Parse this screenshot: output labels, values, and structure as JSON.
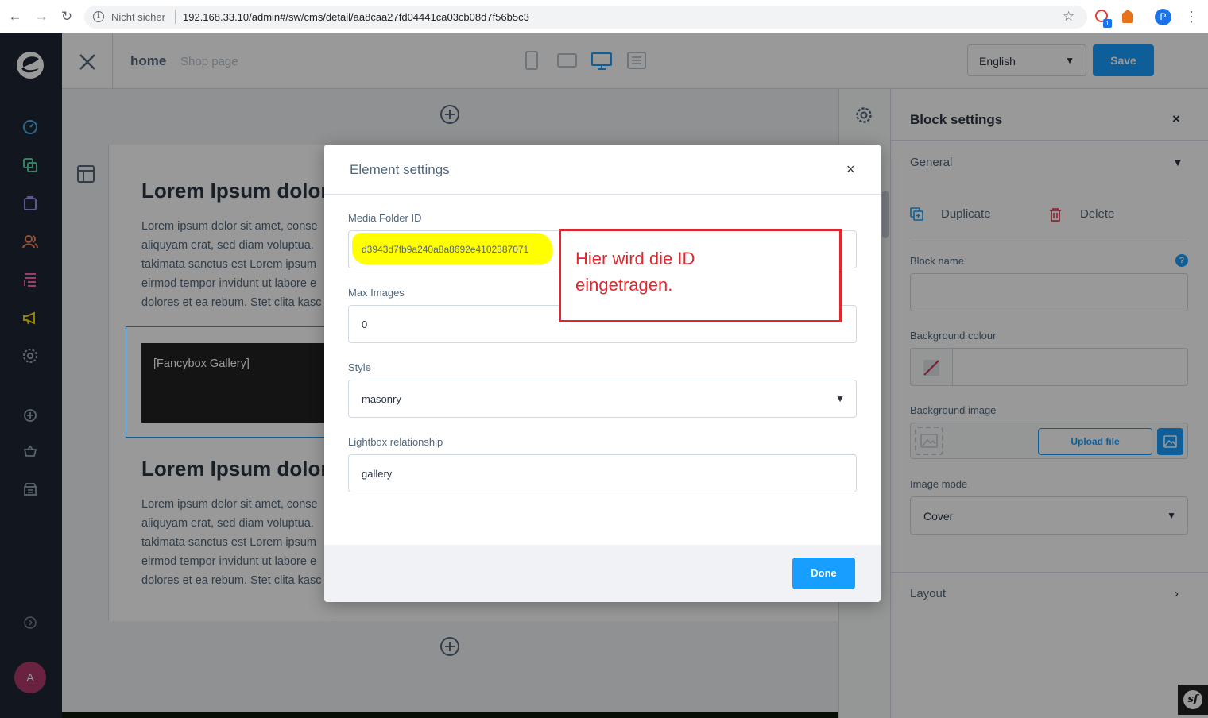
{
  "browser": {
    "back": "←",
    "forward": "→",
    "reload": "↻",
    "security": "Nicht sicher",
    "url": "192.168.33.10/admin#/sw/cms/detail/aa8caa27fd04441ca03cb08d7f56b5c3",
    "star": "☆",
    "ext_badge": "1",
    "profile_initial": "P",
    "menu": "⋮"
  },
  "sidebar": {
    "icons": [
      "dashboard-icon",
      "catalogue-icon",
      "orders-icon",
      "customers-icon",
      "content-icon",
      "marketing-icon",
      "settings-icon",
      "add-icon",
      "sales-channel-icon",
      "storefront-icon",
      "help-icon"
    ],
    "avatar_initial": "A"
  },
  "topbar": {
    "page_title": "home",
    "page_type": "Shop page",
    "language": "English",
    "save_label": "Save"
  },
  "preview": {
    "heading1": "Lorem Ipsum dolor",
    "para1": [
      "Lorem ipsum dolor sit amet, conse",
      "aliquyam erat, sed diam voluptua.",
      "takimata sanctus est Lorem ipsum",
      "eirmod tempor invidunt ut labore e",
      "dolores et ea rebum. Stet clita kasc"
    ],
    "gallery_label": "[Fancybox Gallery]",
    "heading2": "Lorem Ipsum dolor",
    "para2": [
      "Lorem ipsum dolor sit amet, conse",
      "aliquyam erat, sed diam voluptua.",
      "takimata sanctus est Lorem ipsum",
      "eirmod tempor invidunt ut labore e",
      "dolores et ea rebum. Stet clita kasc"
    ]
  },
  "block_settings": {
    "title": "Block settings",
    "close": "×",
    "general": "General",
    "duplicate": "Duplicate",
    "delete": "Delete",
    "block_name_label": "Block name",
    "block_name_value": "",
    "help": "?",
    "bg_colour_label": "Background colour",
    "bg_image_label": "Background image",
    "upload_label": "Upload file",
    "image_mode_label": "Image mode",
    "image_mode_value": "Cover",
    "layout": "Layout"
  },
  "modal": {
    "title": "Element settings",
    "close": "×",
    "media_folder_label": "Media Folder ID",
    "media_folder_value": "d3943d7fb9a240a8a8692e4102387071",
    "max_images_label": "Max Images",
    "max_images_value": "0",
    "style_label": "Style",
    "style_value": "masonry",
    "lightbox_label": "Lightbox relationship",
    "lightbox_value": "gallery",
    "done_label": "Done"
  },
  "annotation": {
    "text": "Hier wird die ID\neingetragen."
  },
  "colors": {
    "accent": "#189eff",
    "sidebar": "#1f2532",
    "annotation": "#e3262e",
    "highlight": "#ffff00"
  }
}
